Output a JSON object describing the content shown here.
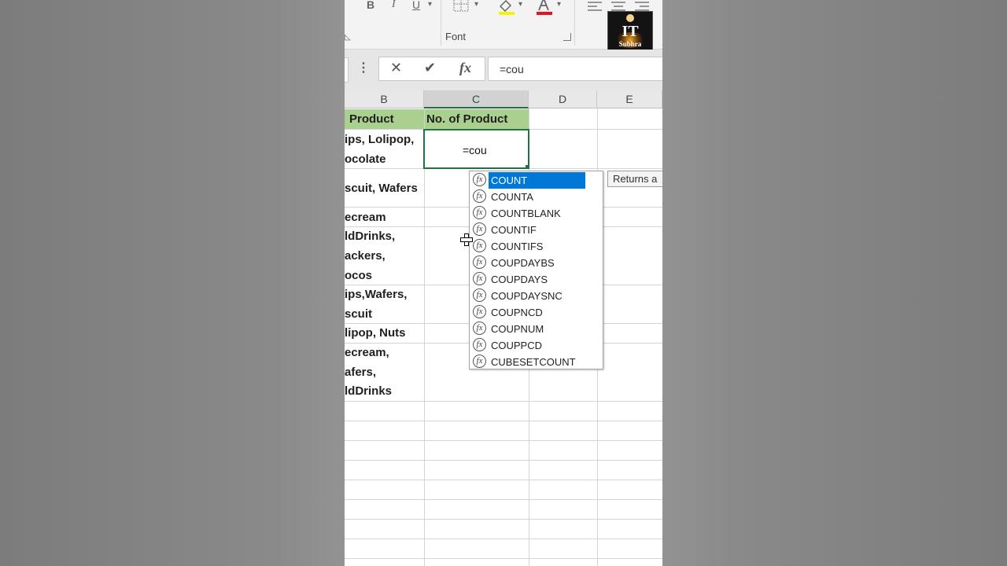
{
  "ribbon": {
    "font_group_label": "Font",
    "buttons": {
      "bold": "B",
      "italic": "I",
      "underline": "U"
    }
  },
  "logo": {
    "title": "IT",
    "subtitle": "Subhra"
  },
  "formula_bar": {
    "cancel_icon": "✕",
    "enter_icon": "✔",
    "function_icon": "fx",
    "value": "=cou"
  },
  "columns": [
    "B",
    "C",
    "D",
    "E"
  ],
  "sheet": {
    "header_b": "Product",
    "header_c": "No. of Product",
    "column_b_lines": [
      "ips, Lolipop,",
      "ocolate",
      "scuit, Wafers",
      "ecream",
      "ldDrinks,",
      "ackers,",
      "ocos",
      "ips,Wafers,",
      "scuit",
      "lipop, Nuts",
      "ecream,",
      "afers,",
      "ldDrinks"
    ],
    "active_cell_value": "=cou"
  },
  "autocomplete": {
    "icon_text": "fx",
    "items": [
      "COUNT",
      "COUNTA",
      "COUNTBLANK",
      "COUNTIF",
      "COUNTIFS",
      "COUPDAYBS",
      "COUPDAYS",
      "COUPDAYSNC",
      "COUPNCD",
      "COUPNUM",
      "COUPPCD",
      "CUBESETCOUNT"
    ],
    "selected": "COUNT",
    "tooltip": "Returns a"
  }
}
